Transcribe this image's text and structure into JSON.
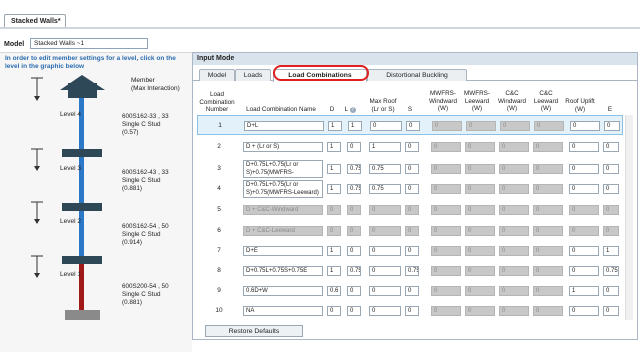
{
  "document_tab": "Stacked Walls*",
  "model": {
    "label": "Model",
    "value": "Stacked Walls ~1"
  },
  "left": {
    "hint": "In order to edit member settings for a level, click on the level in the graphic below",
    "member_title_line1": "Member",
    "member_title_line2": "(Max Interaction)",
    "levels": [
      {
        "name": "Level 4",
        "member": "600S162-33 , 33",
        "type": "Single C Stud",
        "ratio": "(0.57)"
      },
      {
        "name": "Level 3",
        "member": "600S162-43 , 33",
        "type": "Single C Stud",
        "ratio": "(0.881)"
      },
      {
        "name": "Level 2",
        "member": "600S162-54 , 50",
        "type": "Single C Stud",
        "ratio": "(0.914)"
      },
      {
        "name": "Level 1",
        "member": "600S200-54 , 50",
        "type": "Single C Stud",
        "ratio": "(0.881)"
      }
    ]
  },
  "input_mode": {
    "title": "Input Mode",
    "tabs": [
      "Model",
      "Loads",
      "Load Combinations",
      "Distortional Buckling"
    ],
    "active_tab": "Load Combinations"
  },
  "table": {
    "headers": {
      "num": "Load Combination Number",
      "name": "Load Combination Name",
      "d": "D",
      "l": "L",
      "roof": "Max Roof (Lr or S)",
      "s": "S",
      "mw": "MWFRS- Windward (W)",
      "ml": "MWFRS- Leeward (W)",
      "cw": "C&C Windward (W)",
      "cl": "C&C Leeward (W)",
      "up": "Roof Uplift (W)",
      "e": "E"
    },
    "rows": [
      {
        "num": "1",
        "name": "D+L",
        "d": "1",
        "l": "1",
        "roof": "0",
        "s": "0",
        "mw": "0",
        "ml": "0",
        "cw": "0",
        "cl": "0",
        "up": "0",
        "e": "0"
      },
      {
        "num": "2",
        "name": "D + (Lr or S)",
        "d": "1",
        "l": "0",
        "roof": "1",
        "s": "0",
        "mw": "0",
        "ml": "0",
        "cw": "0",
        "cl": "0",
        "up": "0",
        "e": "0"
      },
      {
        "num": "3",
        "name": "D+0.75L+0.75(Lr or S)+0.75(MWFRS-Windward)",
        "d": "1",
        "l": "0.75",
        "roof": "0.75",
        "s": "0",
        "mw": "0",
        "ml": "0",
        "cw": "0",
        "cl": "0",
        "up": "0",
        "e": "0"
      },
      {
        "num": "4",
        "name": "D+0.75L+0.75(Lr or S)+0.75(MWFRS-Leeward)",
        "d": "1",
        "l": "0.75",
        "roof": "0.75",
        "s": "0",
        "mw": "0",
        "ml": "0",
        "cw": "0",
        "cl": "0",
        "up": "0",
        "e": "0"
      },
      {
        "num": "5",
        "name": "D + C&C-Windward",
        "d": "0",
        "l": "0",
        "roof": "0",
        "s": "0",
        "mw": "0",
        "ml": "0",
        "cw": "0",
        "cl": "0",
        "up": "0",
        "e": "0"
      },
      {
        "num": "6",
        "name": "D + C&C-Leeward",
        "d": "0",
        "l": "0",
        "roof": "0",
        "s": "0",
        "mw": "0",
        "ml": "0",
        "cw": "0",
        "cl": "0",
        "up": "0",
        "e": "0"
      },
      {
        "num": "7",
        "name": "D+E",
        "d": "1",
        "l": "0",
        "roof": "0",
        "s": "0",
        "mw": "0",
        "ml": "0",
        "cw": "0",
        "cl": "0",
        "up": "0",
        "e": "1"
      },
      {
        "num": "8",
        "name": "D+0.75L+0.75S+0.75E",
        "d": "1",
        "l": "0.75",
        "roof": "0",
        "s": "0.75",
        "mw": "0",
        "ml": "0",
        "cw": "0",
        "cl": "0",
        "up": "0",
        "e": "0.75"
      },
      {
        "num": "9",
        "name": "0.6D+W",
        "d": "0.6",
        "l": "0",
        "roof": "0",
        "s": "0",
        "mw": "0",
        "ml": "0",
        "cw": "0",
        "cl": "0",
        "up": "1",
        "e": "0"
      },
      {
        "num": "10",
        "name": "NA",
        "d": "0",
        "l": "0",
        "roof": "0",
        "s": "0",
        "mw": "0",
        "ml": "0",
        "cw": "0",
        "cl": "0",
        "up": "0",
        "e": "0"
      }
    ]
  },
  "restore_label": "Restore Defaults",
  "colors": {
    "stud_blue": "#2b78c9",
    "stud_red": "#a01818",
    "plate": "#2f4858",
    "highlight": "#e02020"
  }
}
